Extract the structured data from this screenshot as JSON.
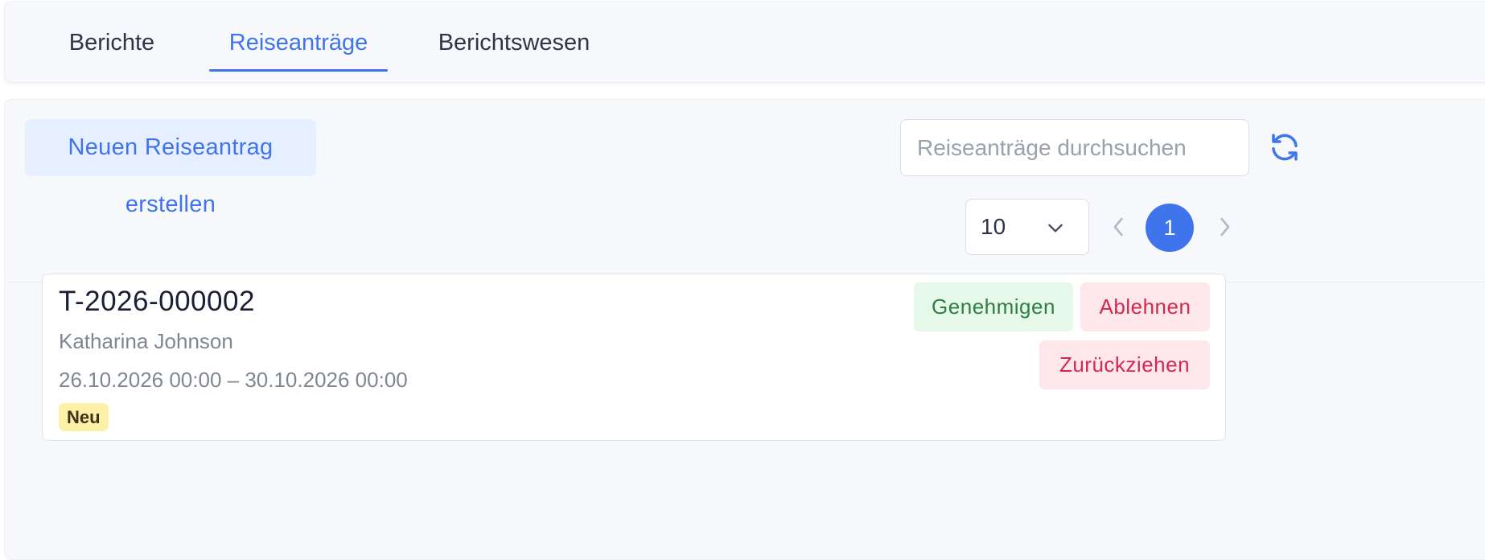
{
  "tabs": [
    {
      "label": "Berichte",
      "active": false
    },
    {
      "label": "Reiseanträge",
      "active": true
    },
    {
      "label": "Berichtswesen",
      "active": false
    }
  ],
  "toolbar": {
    "create_label": "Neuen Reiseantrag erstellen",
    "search_placeholder": "Reiseanträge durchsuchen",
    "search_value": "",
    "refresh_icon": "refresh-icon"
  },
  "pagination": {
    "page_size": "10",
    "current_page": "1",
    "prev_icon": "chevron-left-icon",
    "next_icon": "chevron-right-icon"
  },
  "requests": [
    {
      "id": "T-2026-000002",
      "name": "Katharina Johnson",
      "dates": "26.10.2026 00:00 – 30.10.2026 00:00",
      "status": "Neu",
      "actions": {
        "approve": "Genehmigen",
        "reject": "Ablehnen",
        "withdraw": "Zurückziehen"
      }
    }
  ],
  "colors": {
    "accent": "#3f74ec",
    "approve": "#2f7f45",
    "reject": "#cf2a52",
    "badge_bg": "#fdf0a8"
  }
}
